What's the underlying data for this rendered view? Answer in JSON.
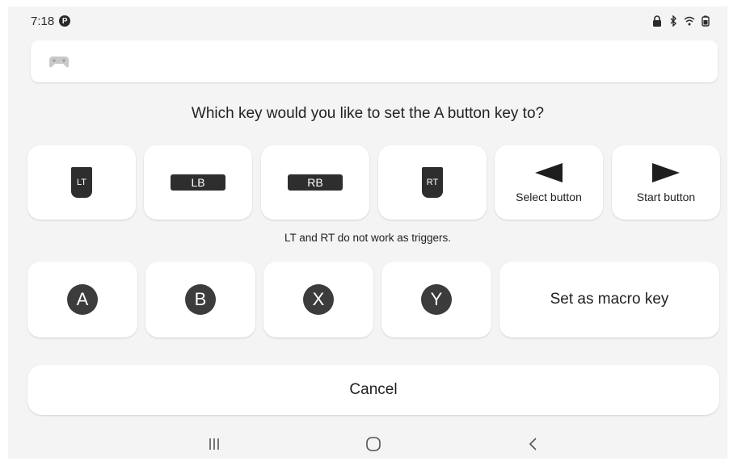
{
  "status_bar": {
    "time": "7:18",
    "icons": [
      "p-app-icon",
      "lock-icon",
      "bluetooth-icon",
      "wifi-icon",
      "battery-icon"
    ]
  },
  "top_card": {
    "icon": "gamepad-icon"
  },
  "prompt": "Which key would you like to set the A button key to?",
  "keys_row1": [
    {
      "label": "LT",
      "type": "trigger"
    },
    {
      "label": "LB",
      "type": "bumper"
    },
    {
      "label": "RB",
      "type": "bumper"
    },
    {
      "label": "RT",
      "type": "trigger"
    },
    {
      "label": "Select button",
      "type": "triangle-left"
    },
    {
      "label": "Start button",
      "type": "triangle-right"
    }
  ],
  "note": "LT and RT do not work as triggers.",
  "keys_row2": [
    {
      "label": "A"
    },
    {
      "label": "B"
    },
    {
      "label": "X"
    },
    {
      "label": "Y"
    }
  ],
  "macro_label": "Set as macro key",
  "cancel_label": "Cancel",
  "nav": [
    "recents-icon",
    "home-icon",
    "back-icon"
  ],
  "colors": {
    "background": "#f4f4f4",
    "card": "#ffffff",
    "key_dark": "#2e2e2e"
  }
}
